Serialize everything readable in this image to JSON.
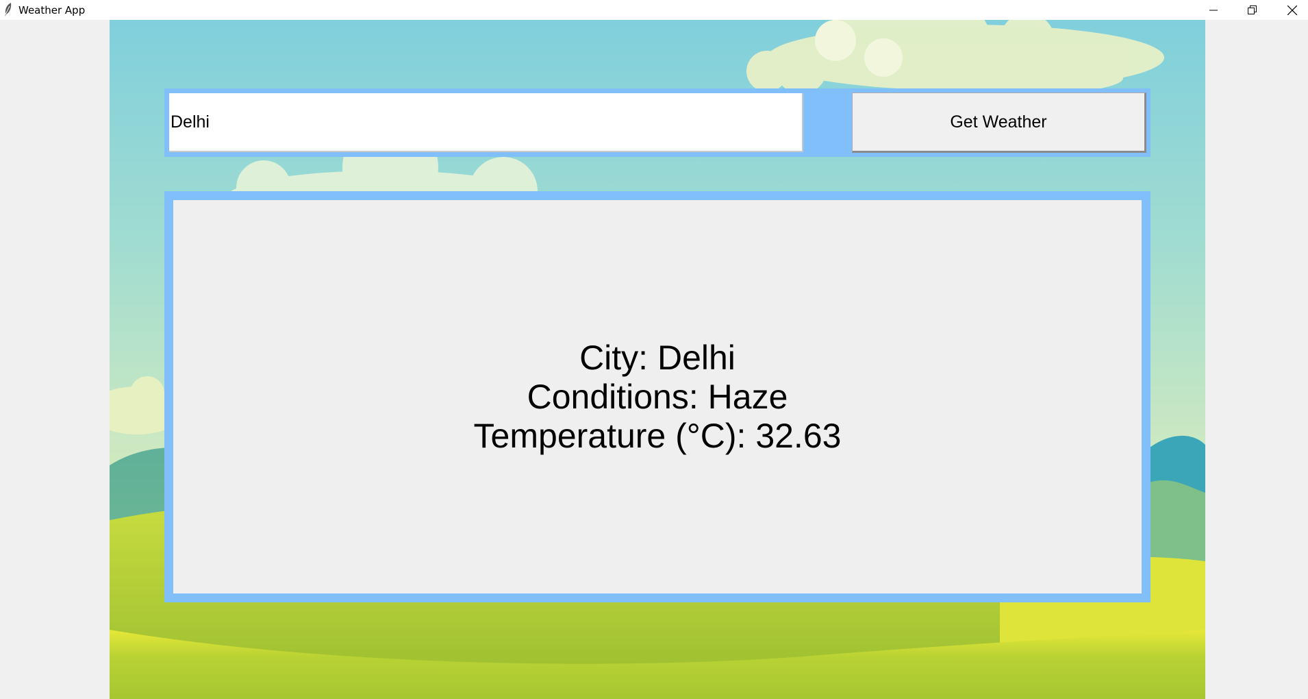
{
  "window": {
    "title": "Weather App",
    "app_icon": "feather-icon",
    "controls": [
      "minimize-icon",
      "restore-icon",
      "close-icon"
    ]
  },
  "search": {
    "city_value": "Delhi",
    "button_label": "Get Weather"
  },
  "result": {
    "city_line": "City: Delhi",
    "conditions_line": "Conditions: Haze",
    "temperature_line": "Temperature (°C): 32.63"
  },
  "colors": {
    "frame_accent": "#80bffa",
    "sky_top": "#86d1dc",
    "grass": "#a8c83a"
  }
}
